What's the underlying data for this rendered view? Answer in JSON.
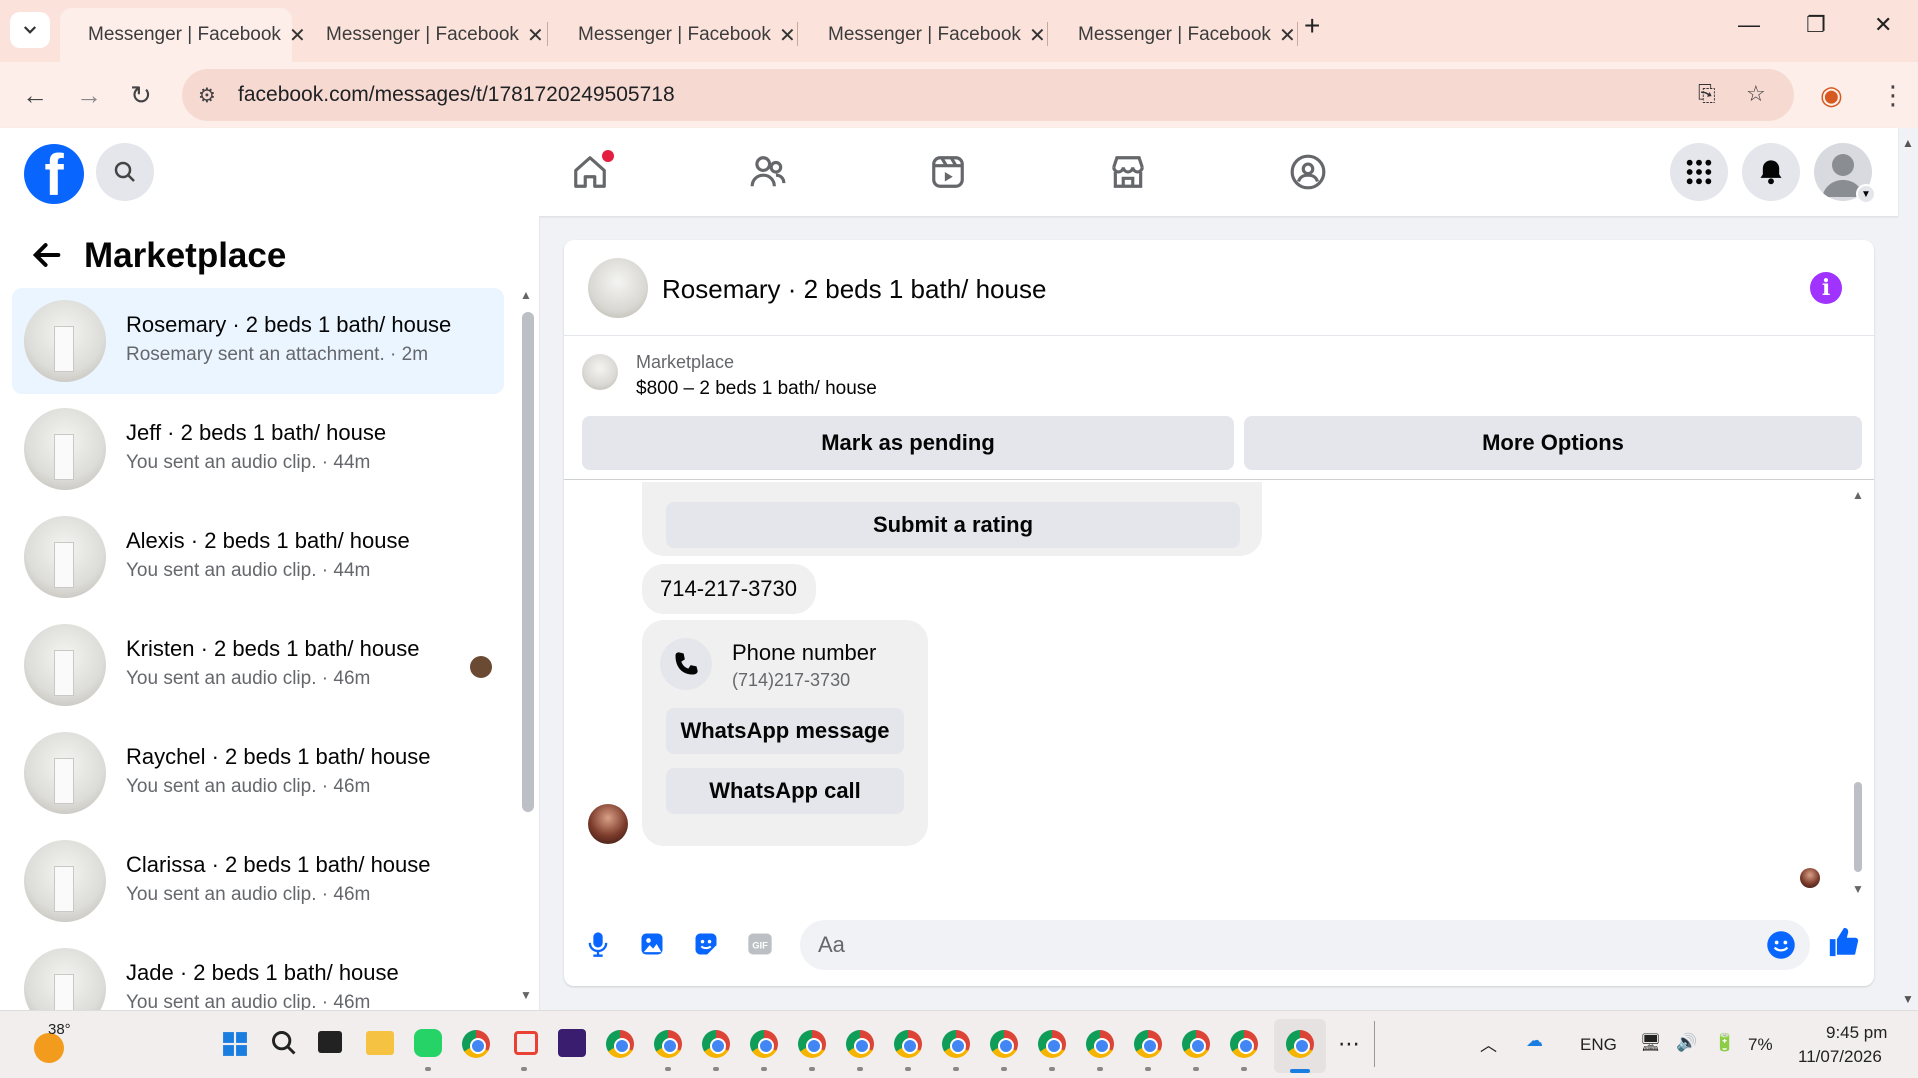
{
  "browser": {
    "tabs": [
      {
        "title": "Messenger | Facebook"
      },
      {
        "title": "Messenger | Facebook"
      },
      {
        "title": "Messenger | Facebook"
      },
      {
        "title": "Messenger | Facebook"
      },
      {
        "title": "Messenger | Facebook"
      }
    ],
    "url": "facebook.com/messages/t/1781720249505718"
  },
  "header": {
    "logo_letter": "f"
  },
  "left_pane": {
    "title": "Marketplace",
    "conversations": [
      {
        "name": "Rosemary · 2 beds 1 bath/ house",
        "subtitle": "Rosemary sent an attachment. · 2m"
      },
      {
        "name": "Jeff · 2 beds 1 bath/ house",
        "subtitle": "You sent an audio clip. · 44m"
      },
      {
        "name": "Alexis · 2 beds 1 bath/ house",
        "subtitle": "You sent an audio clip. · 44m"
      },
      {
        "name": "Kristen · 2 beds 1 bath/ house",
        "subtitle": "You sent an audio clip. · 46m"
      },
      {
        "name": "Raychel · 2 beds 1 bath/ house",
        "subtitle": "You sent an audio clip. · 46m"
      },
      {
        "name": "Clarissa · 2 beds 1 bath/ house",
        "subtitle": "You sent an audio clip. · 46m"
      },
      {
        "name": "Jade · 2 beds 1 bath/ house",
        "subtitle": "You sent an audio clip. · 46m"
      }
    ]
  },
  "chat": {
    "title": "Rosemary · 2 beds 1 bath/ house",
    "info_letter": "i",
    "marketplace_label": "Marketplace",
    "listing": "$800 – 2 beds 1 bath/ house",
    "mark_pending": "Mark as pending",
    "more_options": "More Options",
    "submit_rating": "Submit a rating",
    "phone_message": "714-217-3730",
    "phone_card_title": "Phone number",
    "phone_card_number": "(714)217-3730",
    "whatsapp_message": "WhatsApp message",
    "whatsapp_call": "WhatsApp call",
    "composer_placeholder": "Aa"
  },
  "taskbar": {
    "temperature": "38°",
    "language": "ENG",
    "battery": "7%",
    "time": "9:45 pm",
    "date": "11/07/2026"
  },
  "colors": {
    "fb_blue": "#0866ff",
    "info_purple": "#a033ff",
    "active_conv": "#ebf5ff",
    "tabbar": "#fbe3dc"
  }
}
